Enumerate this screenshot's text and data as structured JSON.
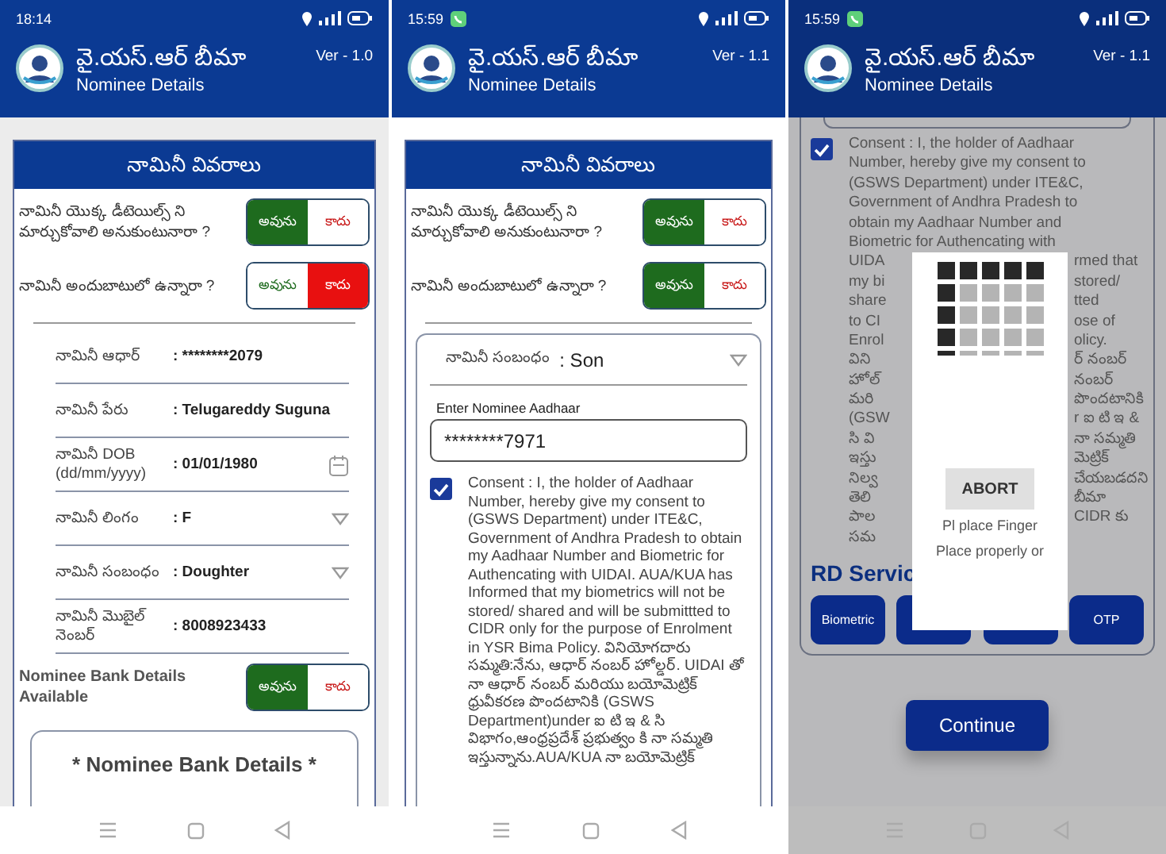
{
  "screens": [
    {
      "kind": "details",
      "status_bar": {
        "time": "18:14"
      },
      "app_bar": {
        "title": "వై.యస్.ఆర్ బీమా",
        "subtitle": "Nominee Details",
        "version": "Ver - 1.0"
      },
      "card_title": "నామినీ వివరాలు",
      "questions": [
        {
          "text": "నామినీ యొక్క డీటెయిల్స్ ని మార్చుకోవాలి అనుకుంటునారా ?",
          "options": [
            {
              "label": "అవును",
              "selected": true
            },
            {
              "label": "కాదు",
              "selected": false
            }
          ]
        },
        {
          "text": "నామినీ అందుబాటులో ఉన్నారా ?",
          "options": [
            {
              "label": "అవును",
              "selected": false
            },
            {
              "label": "కాదు",
              "selected": true
            }
          ]
        }
      ],
      "fields": [
        {
          "kind": "text",
          "label": "నామినీ ఆధార్",
          "value": ": ********2079"
        },
        {
          "kind": "text",
          "label": "నామినీ పేరు",
          "value": ": Telugareddy Suguna"
        },
        {
          "kind": "date",
          "label": "నామినీ DOB (dd/mm/yyyy)",
          "value": ": 01/01/1980"
        },
        {
          "kind": "select",
          "label": "నామినీ లింగం",
          "value": ": F"
        },
        {
          "kind": "select",
          "label": "నామినీ సంబంధం",
          "value": ": Doughter"
        },
        {
          "kind": "text",
          "label": "నామినీ మొబైల్ నెంబర్",
          "value": ": 8008923433"
        }
      ],
      "bank_question": {
        "text": "Nominee Bank Details Available",
        "options": [
          {
            "label": "అవును",
            "selected": true
          },
          {
            "label": "కాదు",
            "selected": false
          }
        ]
      },
      "bank_section": {
        "title": "* Nominee Bank Details *"
      }
    },
    {
      "kind": "consent",
      "status_bar": {
        "time": "15:59",
        "call_indicator": true
      },
      "app_bar": {
        "title": "వై.యస్.ఆర్ బీమా",
        "subtitle": "Nominee Details",
        "version": "Ver - 1.1"
      },
      "card_title": "నామినీ వివరాలు",
      "questions": [
        {
          "text": "నామినీ యొక్క డీటెయిల్స్ ని మార్చుకోవాలి అనుకుంటునారా ?",
          "options": [
            {
              "label": "అవును",
              "selected": true
            },
            {
              "label": "కాదు",
              "selected": false
            }
          ]
        },
        {
          "text": "నామినీ అందుబాటులో ఉన్నారా ?",
          "options": [
            {
              "label": "అవును",
              "selected": true
            },
            {
              "label": "కాదు",
              "selected": false
            }
          ]
        }
      ],
      "relation": {
        "label": "నామినీ సంబంధం",
        "value": ": Son"
      },
      "aadhaar_input": {
        "label": "Enter Nominee Aadhaar",
        "value": "********7971"
      },
      "consent": {
        "checked": true,
        "text": "Consent : I, the holder of Aadhaar Number, hereby give my consent to (GSWS Department) under ITE&C, Government of Andhra Pradesh to obtain my Aadhaar Number and Biometric for Authencating with UIDAI. AUA/KUA has Informed that my biometrics will not be stored/ shared and will be submittted to CIDR only for the purpose of Enrolment in YSR Bima Policy. వినియోగదారు సమ్మతి:నేను, ఆధార్ నంబర్ హోల్డర్. UIDAI తో నా ఆధార్ నంబర్ మరియు బయోమెట్రిక్ ధ్రువీకరణ పొందటానికి (GSWS Department)under ఐ టి ఇ & సి విభాగం,ఆంధ్రప్రదేశ్ ప్రభుత్వం కి నా సమ్మతి ఇస్తున్నాను.AUA/KUA నా బయోమెట్రిక్"
      }
    },
    {
      "kind": "biometric",
      "status_bar": {
        "time": "15:59",
        "call_indicator": true
      },
      "app_bar": {
        "title": "వై.యస్.ఆర్ బీమా",
        "subtitle": "Nominee Details",
        "version": "Ver - 1.1"
      },
      "consent": {
        "checked": true,
        "lines": [
          [
            "Consent : I, the holder of Aadhaar"
          ],
          [
            "Number, hereby give my consent to"
          ],
          [
            "(GSWS Department) under ITE&C,"
          ],
          [
            "Government of Andhra Pradesh to"
          ],
          [
            "obtain my Aadhaar Number and"
          ],
          [
            "Biometric for Authencating with"
          ],
          [
            "UIDA",
            "rmed that"
          ],
          [
            "my bi",
            "stored/"
          ],
          [
            "share",
            "tted"
          ],
          [
            "to CI",
            "ose of"
          ],
          [
            "Enrol",
            "olicy."
          ],
          [
            "విని",
            "ర్ నంబర్"
          ],
          [
            "హోల్",
            "నంబర్"
          ],
          [
            "మరి",
            "పొందటానికి"
          ],
          [
            "(GSW",
            "r ఐ టి ఇ &"
          ],
          [
            "సి వి",
            "నా సమ్మతి"
          ],
          [
            "ఇస్తు",
            "మెట్రిక్"
          ],
          [
            "నిల్వ",
            "చేయబడదని"
          ],
          [
            "తెలి",
            "బీమా"
          ],
          [
            "పాల",
            "CIDR కు"
          ],
          [
            "సమ"
          ]
        ]
      },
      "rd_title": "RD Servic",
      "rd_buttons": [
        {
          "kind": "labeled",
          "label": "Biometric"
        },
        {
          "kind": "blank"
        },
        {
          "kind": "blank"
        },
        {
          "kind": "labeled",
          "label": "OTP"
        }
      ],
      "continue_button": "Continue",
      "dialog": {
        "button": "ABORT",
        "message_lines": [
          "Pl place Finger",
          "Place properly or"
        ]
      }
    }
  ]
}
